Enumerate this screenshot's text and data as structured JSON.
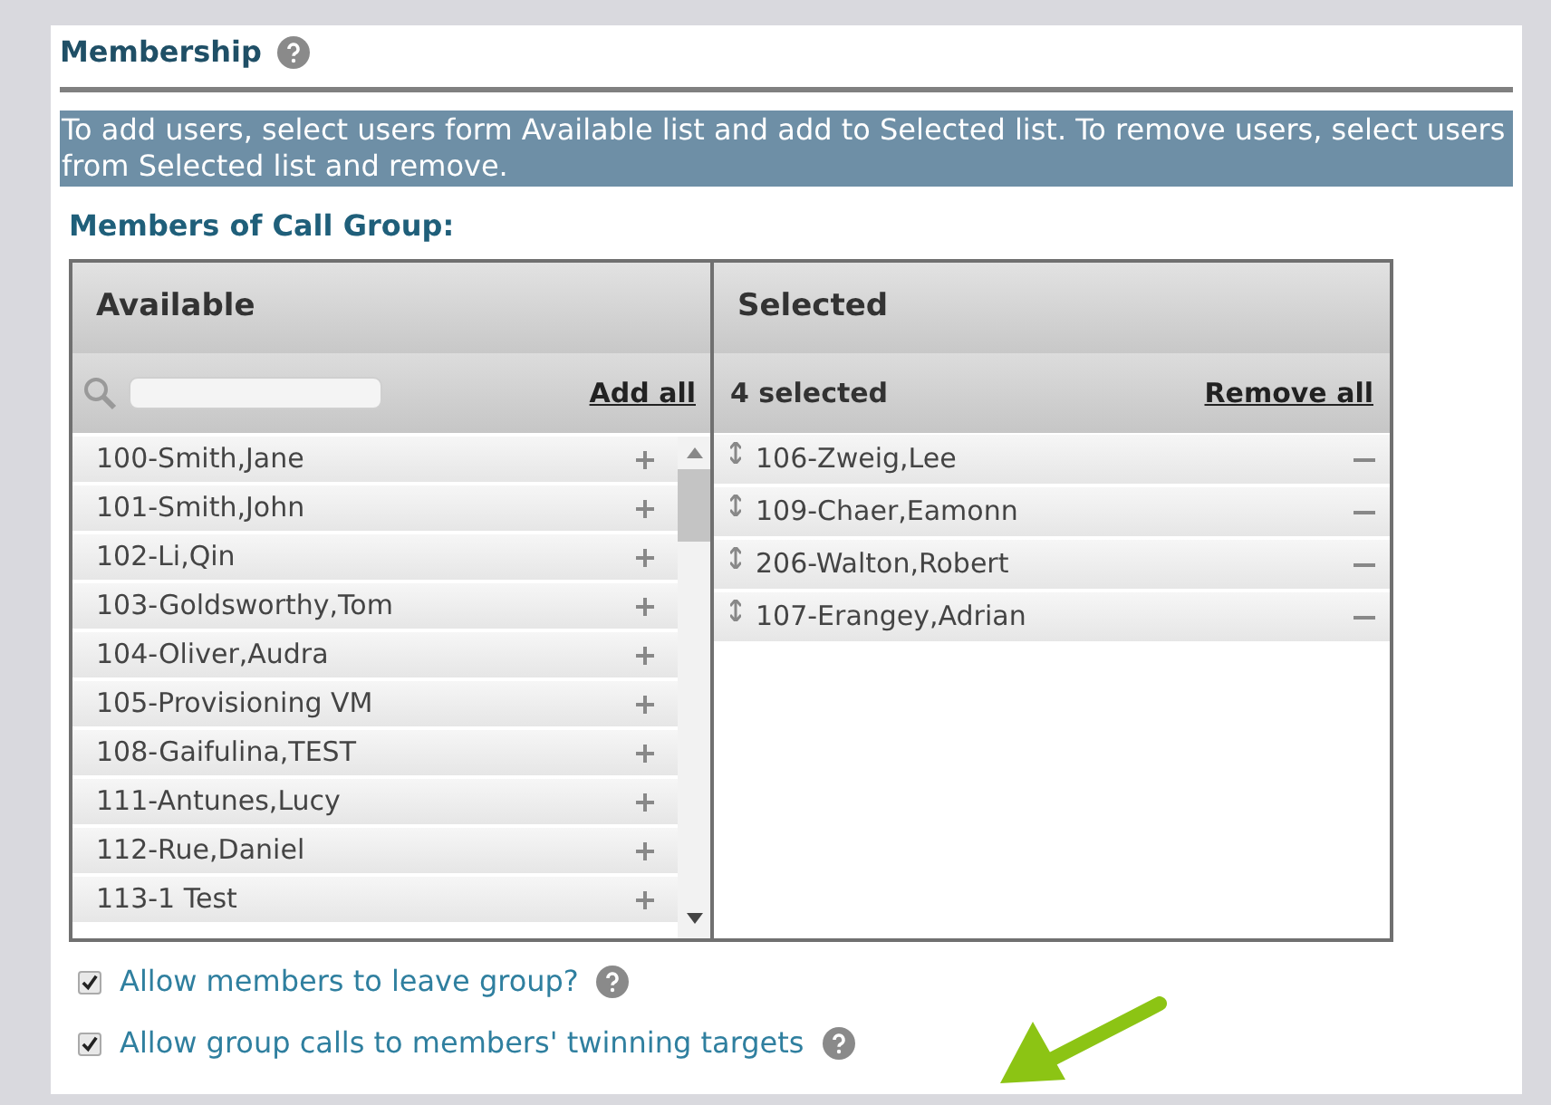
{
  "section": {
    "title": "Membership"
  },
  "instructions": "To add users, select users form Available list and add to Selected list. To remove users, select users from Selected list and remove.",
  "group_label": "Members of Call Group:",
  "available": {
    "heading": "Available",
    "add_all": "Add all",
    "items": [
      {
        "name": "100-Smith,Jane"
      },
      {
        "name": "101-Smith,John"
      },
      {
        "name": "102-Li,Qin"
      },
      {
        "name": "103-Goldsworthy,Tom"
      },
      {
        "name": "104-Oliver,Audra"
      },
      {
        "name": "105-Provisioning VM"
      },
      {
        "name": "108-Gaifulina,TEST"
      },
      {
        "name": "111-Antunes,Lucy"
      },
      {
        "name": "112-Rue,Daniel"
      },
      {
        "name": "113-1 Test"
      }
    ]
  },
  "selected": {
    "heading": "Selected",
    "count": "4 selected",
    "remove_all": "Remove all",
    "items": [
      {
        "name": "106-Zweig,Lee"
      },
      {
        "name": "109-Chaer,Eamonn"
      },
      {
        "name": "206-Walton,Robert"
      },
      {
        "name": "107-Erangey,Adrian"
      }
    ]
  },
  "options": [
    {
      "label": "Allow members to leave group?",
      "checked": true
    },
    {
      "label": "Allow group calls to members' twinning targets",
      "checked": true
    }
  ]
}
